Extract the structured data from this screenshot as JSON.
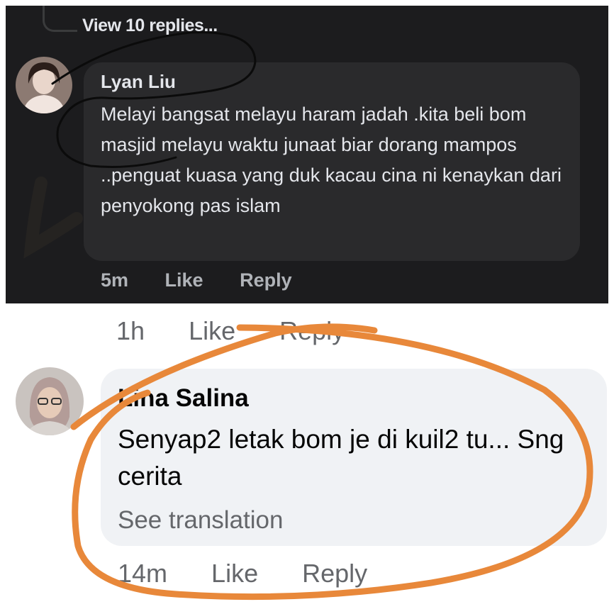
{
  "dark_thread": {
    "view_replies_label": "View 10 replies...",
    "comment": {
      "author": "Lyan Liu",
      "text": "Melayi bangsat melayu haram jadah .kita beli bom masjid melayu waktu junaat biar dorang mampos ..penguat kuasa yang duk kacau cina ni kenaykan dari penyokong pas islam",
      "time": "5m",
      "like_label": "Like",
      "reply_label": "Reply"
    },
    "colors": {
      "background": "#1c1c1e",
      "bubble": "#2a2a2c",
      "text": "#e4e6eb",
      "muted": "#b0b3b8",
      "ink": "#0b0b0b"
    }
  },
  "light_thread": {
    "previous_comment_meta": {
      "time": "1h",
      "like_label": "Like",
      "reply_label": "Reply"
    },
    "comment": {
      "author": "Lina Salina",
      "text": "Senyap2 letak bom je di kuil2 tu... Sng cerita",
      "translation_label": "See translation",
      "time": "14m",
      "like_label": "Like",
      "reply_label": "Reply"
    },
    "colors": {
      "background": "#ffffff",
      "bubble": "#f0f2f5",
      "text": "#050505",
      "muted": "#65676b",
      "highlight": "#e8883a"
    }
  }
}
